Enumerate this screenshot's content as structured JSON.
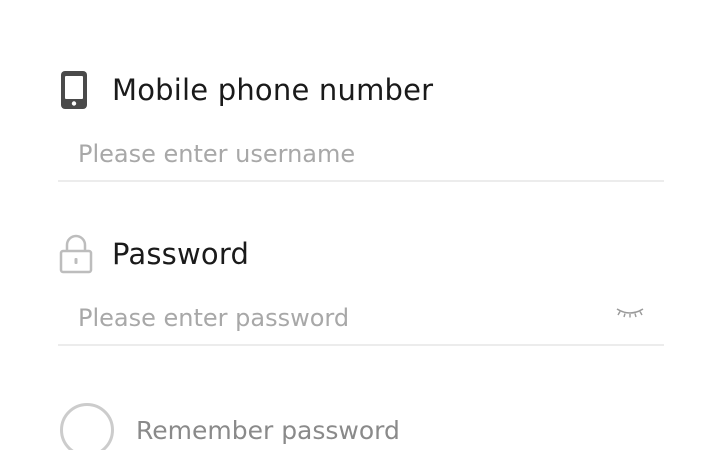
{
  "login_form": {
    "phone": {
      "label": "Mobile phone number",
      "placeholder": "Please enter username",
      "value": "",
      "icon": "phone-icon"
    },
    "password": {
      "label": "Password",
      "placeholder": "Please enter password",
      "value": "",
      "icon": "lock-icon",
      "toggle_icon": "eye-closed-icon"
    },
    "remember": {
      "label": "Remember password",
      "checked": false
    }
  }
}
